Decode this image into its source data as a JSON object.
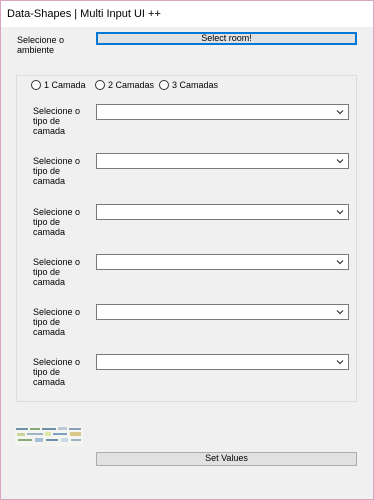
{
  "window": {
    "title": "Data-Shapes | Multi Input UI ++"
  },
  "room": {
    "label_line1": "Selecione o",
    "label_line2": "ambiente",
    "button_label": "Select room!"
  },
  "layers": {
    "radios": [
      {
        "label": "1 Camada",
        "selected": false
      },
      {
        "label": "2 Camadas",
        "selected": false
      },
      {
        "label": "3 Camadas",
        "selected": false
      }
    ],
    "rows": [
      {
        "label_lines": [
          "Selecione o",
          "tipo de",
          "camada"
        ],
        "value": ""
      },
      {
        "label_lines": [
          "Selecione o",
          "tipo de",
          "camada"
        ],
        "value": ""
      },
      {
        "label_lines": [
          "Selecione o",
          "tipo de",
          "camada"
        ],
        "value": ""
      },
      {
        "label_lines": [
          "Selecione o",
          "tipo de",
          "camada"
        ],
        "value": ""
      },
      {
        "label_lines": [
          "Selecione o",
          "tipo de",
          "camada"
        ],
        "value": ""
      },
      {
        "label_lines": [
          "Selecione o",
          "tipo de",
          "camada"
        ],
        "value": ""
      }
    ]
  },
  "footer": {
    "set_values_label": "Set Values"
  },
  "colors": {
    "window_bg": "#f0f0f0",
    "accent_focus": "#0078d7",
    "window_border": "#d9a6c2"
  }
}
